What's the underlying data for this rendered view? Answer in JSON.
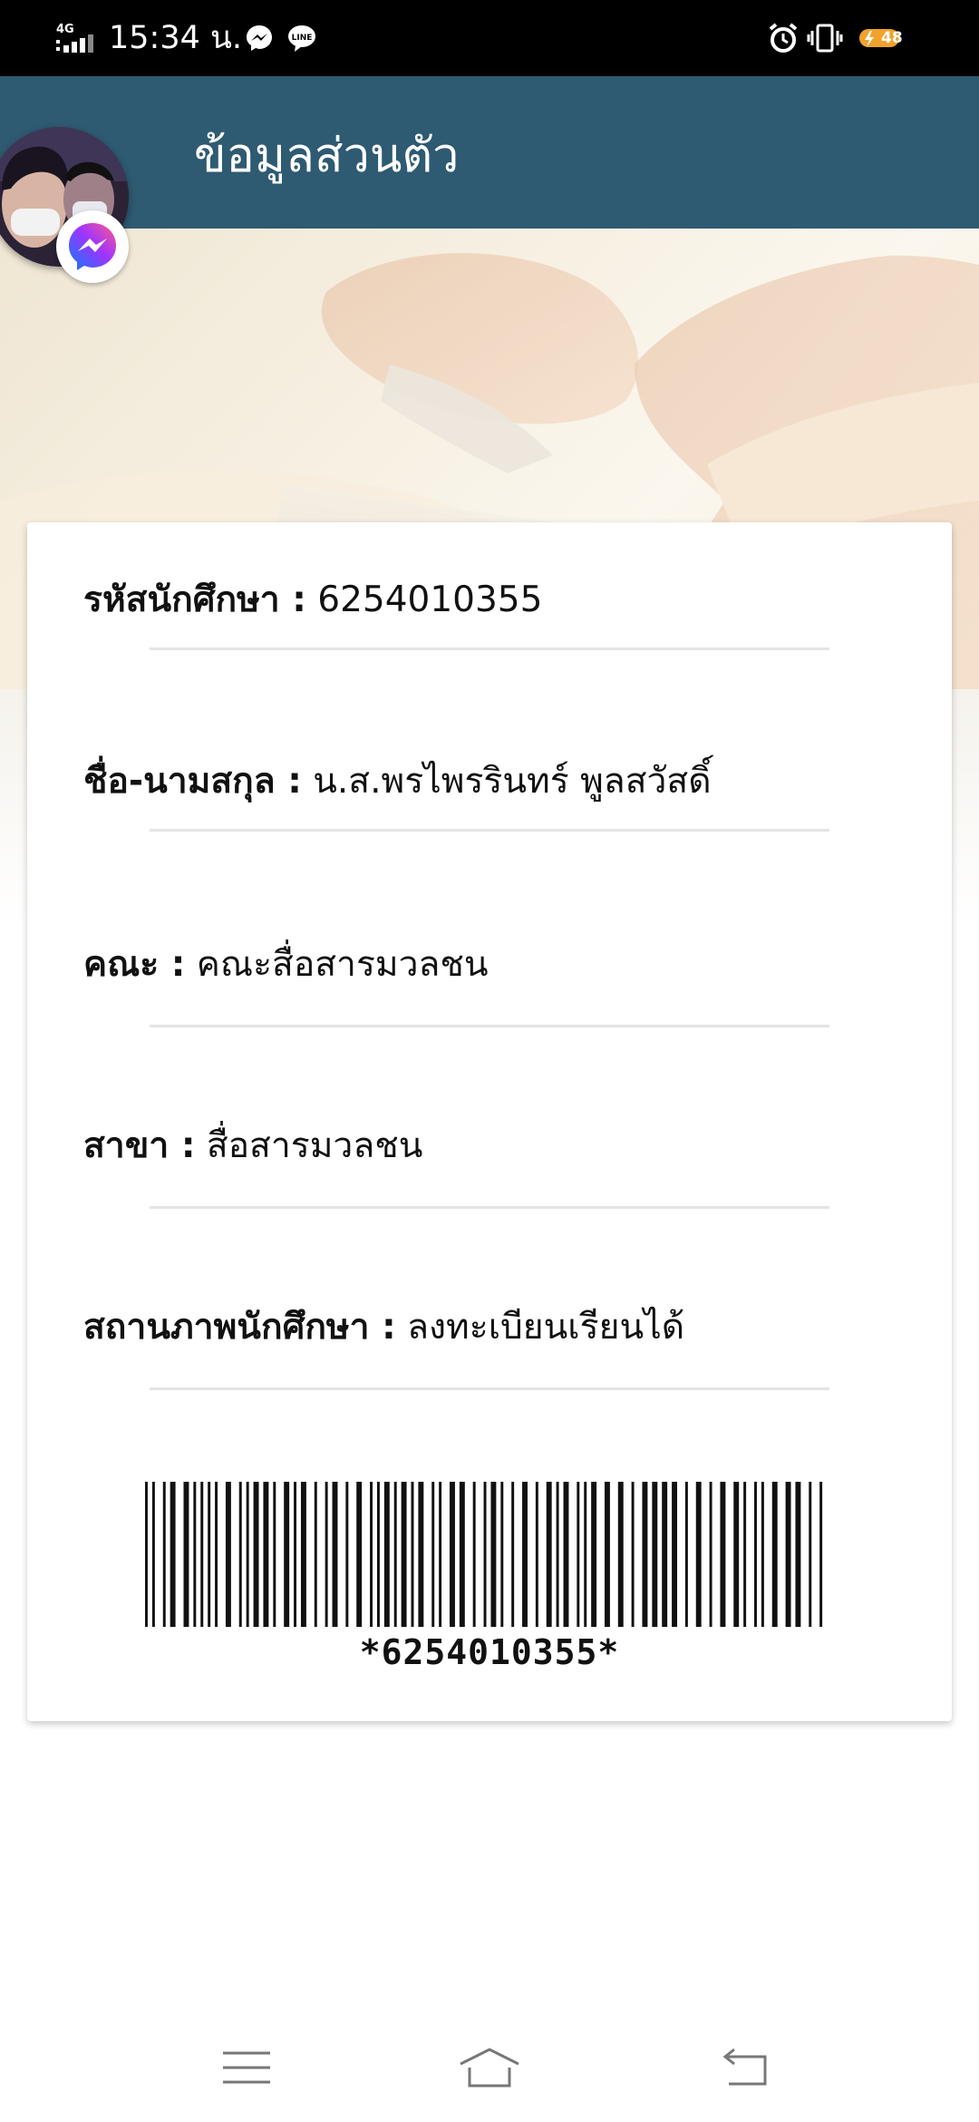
{
  "status_bar": {
    "network": "4G",
    "time": "15:34 น.",
    "battery": "48",
    "icons": [
      "signal-icon",
      "messenger-icon",
      "line-icon",
      "alarm-icon",
      "vibrate-icon",
      "battery-icon"
    ]
  },
  "header": {
    "title": "ข้อมูลส่วนตัว",
    "background_color": "#2e5a72"
  },
  "chat_head": {
    "badge_icon": "messenger-icon"
  },
  "profile": {
    "fields": [
      {
        "label": "รหัสนักศึกษา :",
        "value": " 6254010355"
      },
      {
        "label": "ชื่อ-นามสกุล :",
        "value": " น.ส.พรไพรรินทร์ พูลสวัสดิ์"
      },
      {
        "label": "คณะ :",
        "value": " คณะสื่อสารมวลชน"
      },
      {
        "label": "สาขา :",
        "value": " สื่อสารมวลชน"
      },
      {
        "label": "สถานภาพนักศึกษา :",
        "value": " ลงทะเบียนเรียนได้"
      }
    ],
    "barcode_text": "*6254010355*"
  },
  "nav_bar": {
    "icons": [
      "menu-icon",
      "home-icon",
      "back-icon"
    ]
  }
}
